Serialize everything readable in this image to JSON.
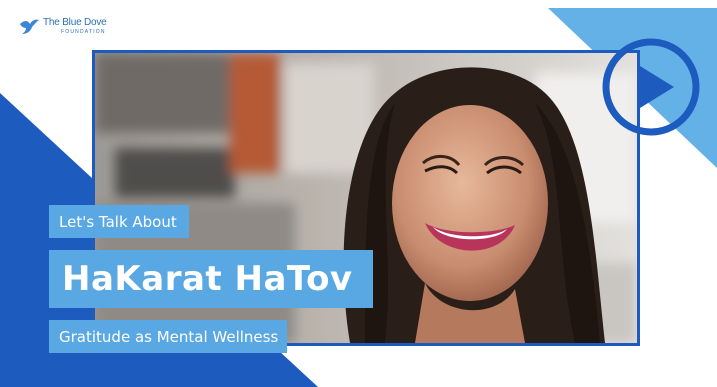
{
  "logo": {
    "name": "The Blue Dove",
    "subtitle": "FOUNDATION"
  },
  "overlay": {
    "intro": "Let's Talk About",
    "title": "HaKarat HaTov",
    "subtitle": "Gratitude as Mental Wellness"
  },
  "colors": {
    "brand_blue": "#1e5bbf",
    "light_blue": "#5aa8e3",
    "sky_blue": "#64b1e8"
  },
  "icons": {
    "play": "play-icon",
    "dove": "dove-icon"
  }
}
